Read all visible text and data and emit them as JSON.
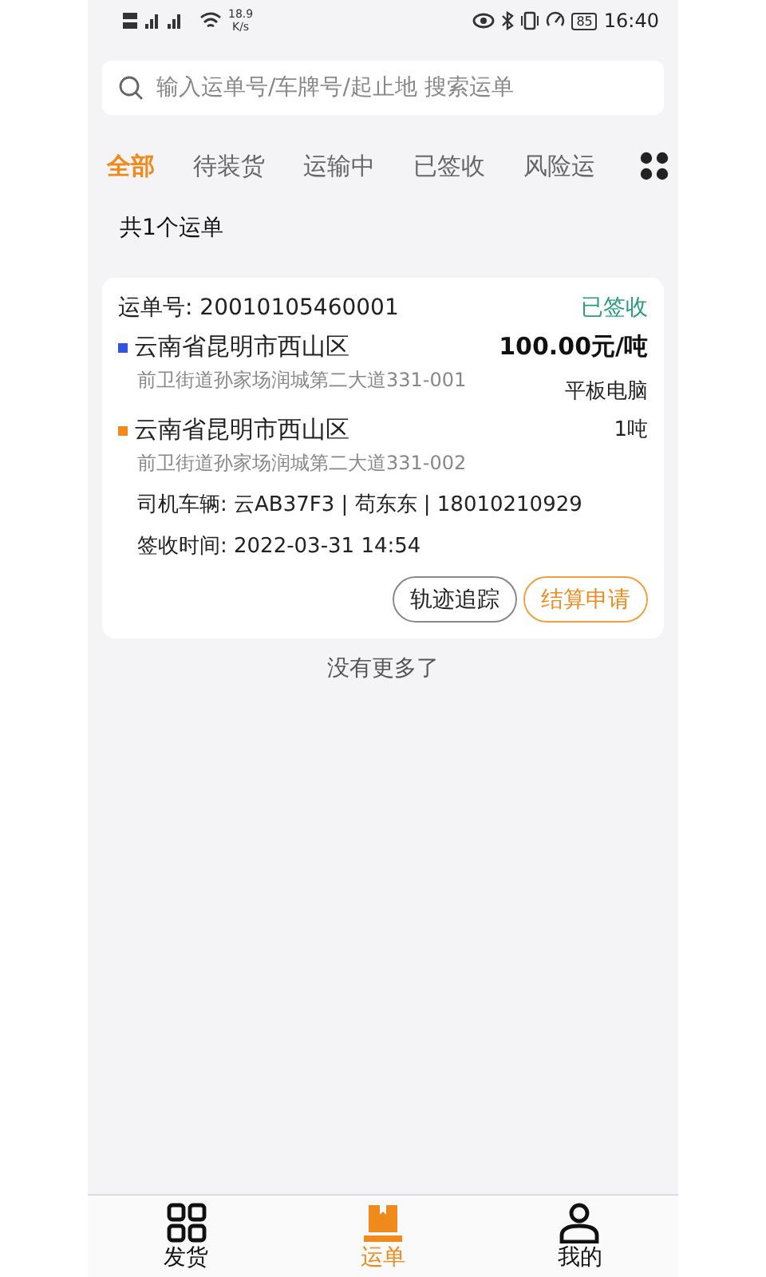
{
  "status_bar": {
    "speed": "18.9",
    "speed_unit": "K/s",
    "battery": "85",
    "time": "16:40"
  },
  "search": {
    "placeholder": "输入运单号/车牌号/起止地 搜索运单"
  },
  "tabs": [
    {
      "label": "全部",
      "selected": true
    },
    {
      "label": "待装货",
      "selected": false
    },
    {
      "label": "运输中",
      "selected": false
    },
    {
      "label": "已签收",
      "selected": false
    },
    {
      "label": "风险运",
      "selected": false
    }
  ],
  "count": "共1个运单",
  "orders": [
    {
      "number_label": "运单号:",
      "number": "20010105460001",
      "status": "已签收",
      "stops": [
        {
          "city": "云南省昆明市西山区",
          "address": "前卫街道孙家场润城第二大道331-001",
          "color": "#3355dd"
        },
        {
          "city": "云南省昆明市西山区",
          "address": "前卫街道孙家场润城第二大道331-002",
          "color": "#f08a1c"
        }
      ],
      "price": "100.00元/吨",
      "goods": "平板电脑",
      "weight": "1吨",
      "driver_label": "司机车辆:",
      "driver": "云AB37F3 | 苟东东 | 18010210929",
      "time_label": "签收时间:",
      "time": "2022-03-31 14:54",
      "buttons": [
        {
          "label": "轨迹追踪",
          "kind": "plain"
        },
        {
          "label": "结算申请",
          "kind": "primary"
        }
      ]
    }
  ],
  "end_note": "没有更多了",
  "nav": [
    {
      "label": "发货",
      "selected": false
    },
    {
      "label": "运单",
      "selected": true
    },
    {
      "label": "我的",
      "selected": false
    }
  ]
}
